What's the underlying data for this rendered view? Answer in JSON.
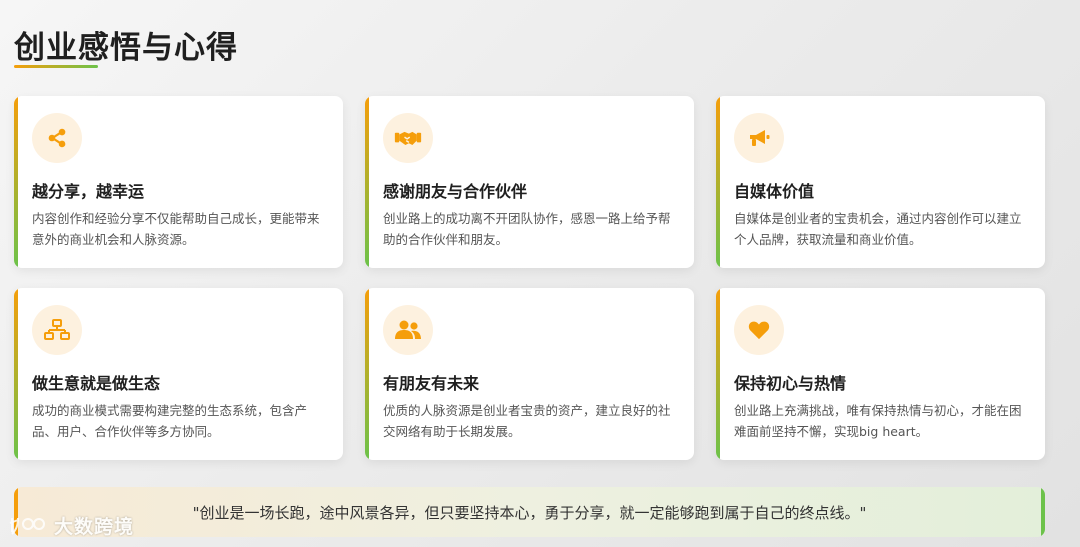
{
  "page": {
    "title": "创业感悟与心得",
    "accent_orange": "#f59e0b",
    "accent_green": "#6cc24a"
  },
  "cards": [
    {
      "icon": "share-icon",
      "title": "越分享，越幸运",
      "desc": "内容创作和经验分享不仅能帮助自己成长，更能带来意外的商业机会和人脉资源。"
    },
    {
      "icon": "handshake-icon",
      "title": "感谢朋友与合作伙伴",
      "desc": "创业路上的成功离不开团队协作，感恩一路上给予帮助的合作伙伴和朋友。"
    },
    {
      "icon": "megaphone-icon",
      "title": "自媒体价值",
      "desc": "自媒体是创业者的宝贵机会，通过内容创作可以建立个人品牌，获取流量和商业价值。"
    },
    {
      "icon": "sitemap-icon",
      "title": "做生意就是做生态",
      "desc": "成功的商业模式需要构建完整的生态系统，包含产品、用户、合作伙伴等多方协同。"
    },
    {
      "icon": "users-icon",
      "title": "有朋友有未来",
      "desc": "优质的人脉资源是创业者宝贵的资产，建立良好的社交网络有助于长期发展。"
    },
    {
      "icon": "heart-icon",
      "title": "保持初心与热情",
      "desc": "创业路上充满挑战，唯有保持热情与初心，才能在困难面前坚持不懈，实现big heart。"
    }
  ],
  "quote": {
    "text": "\"创业是一场长跑，途中风景各异，但只要坚持本心，勇于分享，就一定能够跑到属于自己的终点线。\""
  },
  "watermark": {
    "text": "大数跨境",
    "icon": "brand-logo-icon"
  }
}
